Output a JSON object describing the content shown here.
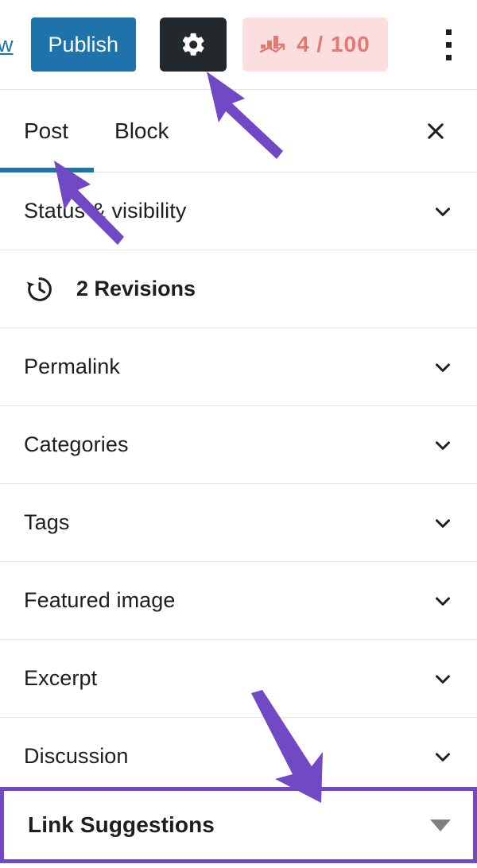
{
  "toolbar": {
    "preview_label": "ew",
    "publish_label": "Publish",
    "settings_icon": "gear-icon",
    "seo": {
      "icon": "bar-chart-icon",
      "score_label": "4 / 100",
      "background_color": "#fbdedd",
      "text_color": "#e07a72"
    },
    "more_menu_icon": "kebab-menu-icon",
    "publish_color": "#1e73aa",
    "settings_button_color": "#23282d"
  },
  "sidebar": {
    "tabs": [
      {
        "label": "Post",
        "active": true
      },
      {
        "label": "Block",
        "active": false
      }
    ],
    "active_indicator_color": "#1e73aa",
    "close_icon": "close-icon",
    "panels": [
      {
        "label": "Status & visibility",
        "control": "chevron-down-icon"
      },
      {
        "label": "2 Revisions",
        "control": "revision-history-icon",
        "type": "revisions"
      },
      {
        "label": "Permalink",
        "control": "chevron-down-icon"
      },
      {
        "label": "Categories",
        "control": "chevron-down-icon"
      },
      {
        "label": "Tags",
        "control": "chevron-down-icon"
      },
      {
        "label": "Featured image",
        "control": "chevron-down-icon"
      },
      {
        "label": "Excerpt",
        "control": "chevron-down-icon"
      },
      {
        "label": "Discussion",
        "control": "chevron-down-icon"
      }
    ],
    "highlighted_panel": {
      "label": "Link Suggestions",
      "control": "triangle-down-icon",
      "highlight_color": "#7249c4"
    }
  },
  "annotations": {
    "color": "#7249c4",
    "arrows": [
      {
        "name": "arrow-to-settings-gear",
        "direction": "up-left"
      },
      {
        "name": "arrow-to-post-tab",
        "direction": "up-left"
      },
      {
        "name": "arrow-to-link-suggestions",
        "direction": "down-right"
      }
    ]
  }
}
